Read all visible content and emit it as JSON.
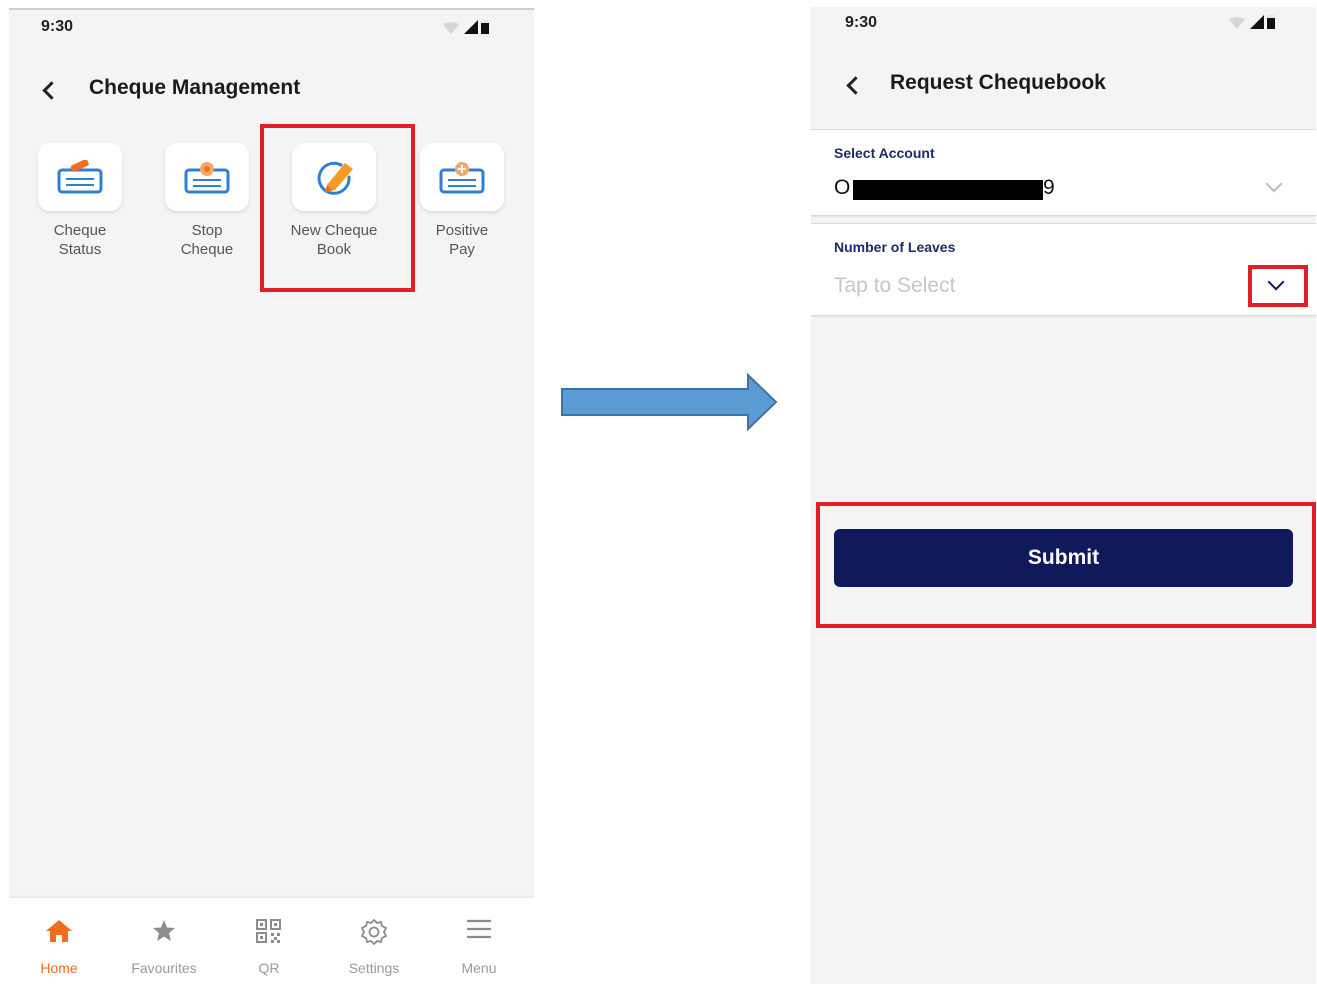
{
  "colors": {
    "brand_orange": "#f26c21",
    "navy": "#10195a",
    "label_navy": "#1d2b6b",
    "highlight_red": "#e21f26",
    "arrow_blue": "#5b9bd5"
  },
  "left_screen": {
    "status_time": "9:30",
    "title": "Cheque Management",
    "back_icon": "back-chevron-icon",
    "tiles": [
      {
        "line1": "Cheque",
        "line2": "Status",
        "icon": "cheque-edit-icon"
      },
      {
        "line1": "Stop",
        "line2": "Cheque",
        "icon": "cheque-stop-icon"
      },
      {
        "line1": "New Cheque",
        "line2": "Book",
        "icon": "pencil-circle-icon"
      },
      {
        "line1": "Positive",
        "line2": "Pay",
        "icon": "cheque-positive-icon"
      }
    ],
    "bottom_nav": [
      {
        "label": "Home",
        "icon": "home-icon",
        "active": true
      },
      {
        "label": "Favourites",
        "icon": "star-icon",
        "active": false
      },
      {
        "label": "QR",
        "icon": "qr-icon",
        "active": false
      },
      {
        "label": "Settings",
        "icon": "gear-icon",
        "active": false
      },
      {
        "label": "Menu",
        "icon": "menu-icon",
        "active": false
      }
    ]
  },
  "right_screen": {
    "status_time": "9:30",
    "title": "Request Chequebook",
    "back_icon": "back-chevron-icon",
    "select_account": {
      "label": "Select Account",
      "value_prefix": "O",
      "value_suffix": "9"
    },
    "number_of_leaves": {
      "label": "Number of Leaves",
      "placeholder": "Tap to Select"
    },
    "submit_label": "Submit"
  }
}
